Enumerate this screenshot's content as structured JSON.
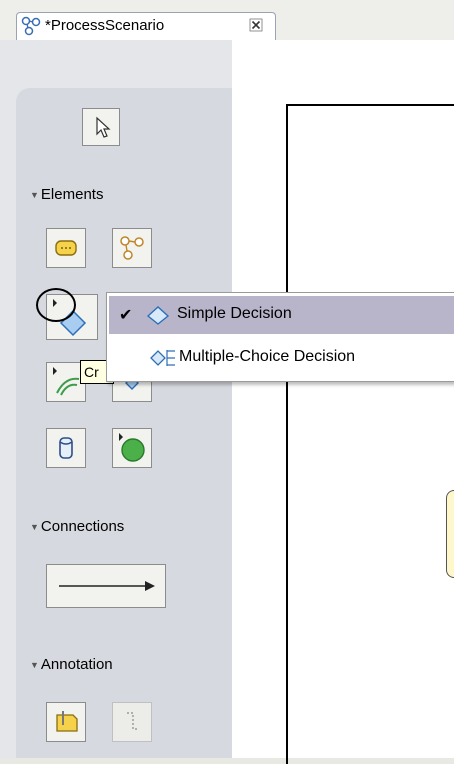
{
  "editor": {
    "tab_title": "*ProcessScenario"
  },
  "palette": {
    "selection_tool": "select-arrow",
    "sections": {
      "elements": "Elements",
      "connections": "Connections",
      "annotation": "Annotation"
    }
  },
  "decision_menu": {
    "items": [
      {
        "label": "Simple Decision",
        "checked": true
      },
      {
        "label": "Multiple-Choice Decision",
        "checked": false
      }
    ]
  },
  "tooltip": {
    "text": "Cr"
  },
  "colors": {
    "menu_selection": "#b8b4ca",
    "palette_bg": "#d6d9df",
    "tooltip_bg": "#ffffe1"
  }
}
